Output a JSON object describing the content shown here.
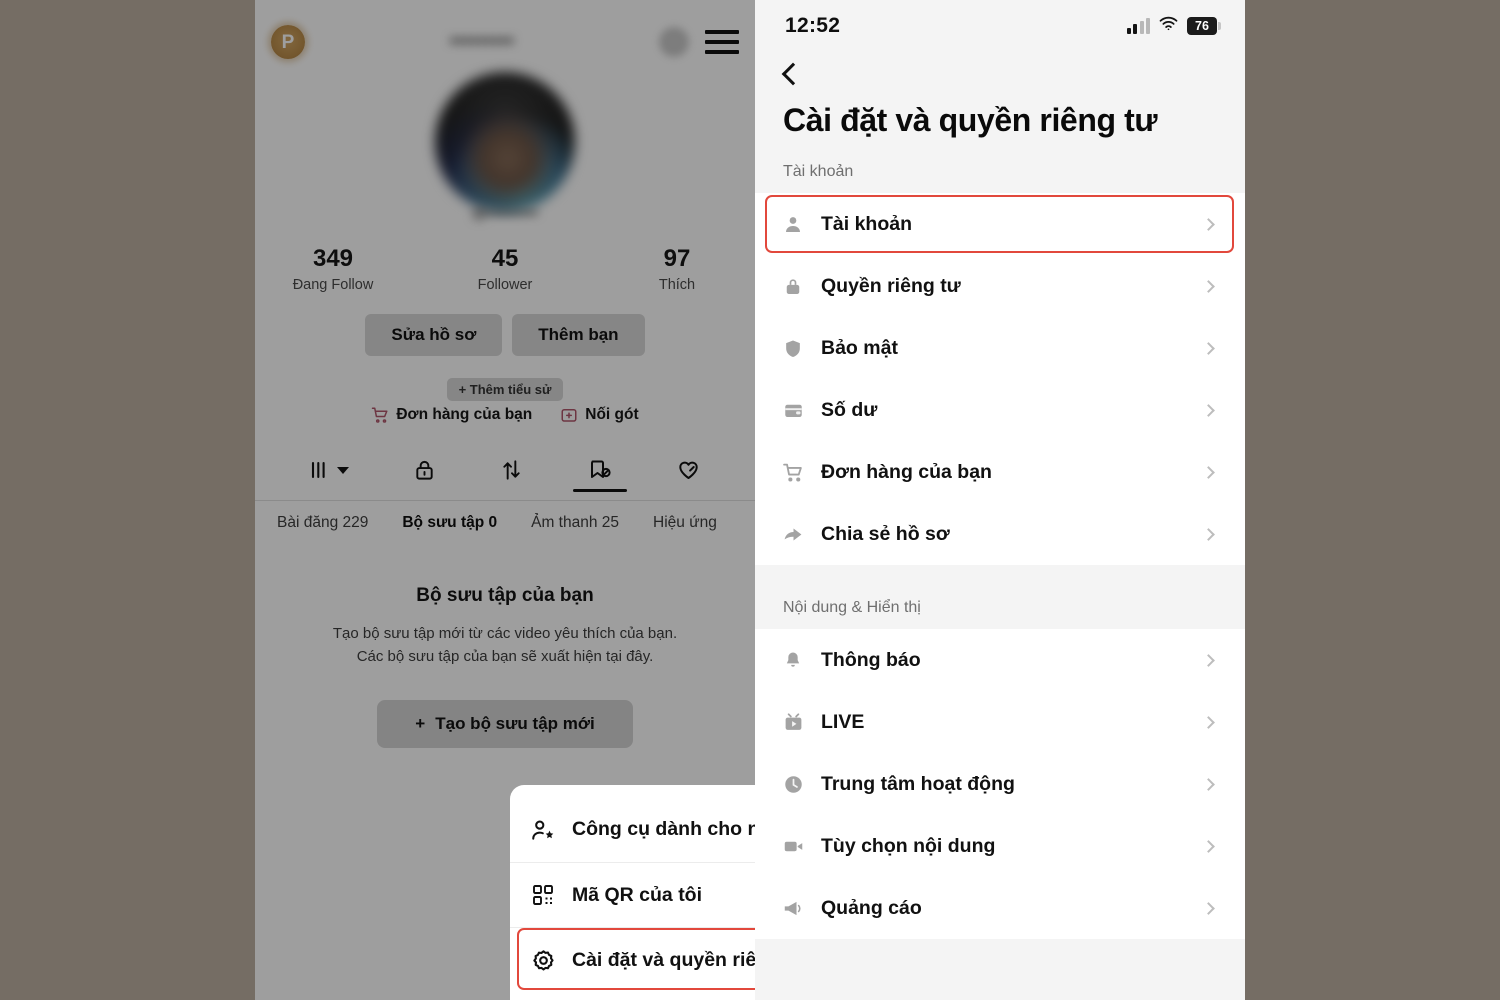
{
  "colors": {
    "page_background": "#756d64",
    "highlight_border": "#e2483c",
    "badge_dot": "#ea1f4e",
    "shop_accent": "#e8456b",
    "profile_badge": "#e08c12"
  },
  "left_phone": {
    "profile": {
      "badge_letter": "P",
      "username_hidden": "",
      "handle_hidden": "",
      "stats": [
        {
          "count": "349",
          "label": "Đang Follow"
        },
        {
          "count": "45",
          "label": "Follower"
        },
        {
          "count": "97",
          "label": "Thích"
        }
      ],
      "actions": [
        {
          "label": "Sửa hồ sơ"
        },
        {
          "label": "Thêm bạn"
        }
      ],
      "add_bio_label": "+ Thêm tiểu sử",
      "shop_links": [
        {
          "label": "Đơn hàng của bạn",
          "icon": "cart-icon"
        },
        {
          "label": "Nối gót",
          "icon": "box-plus-icon"
        }
      ],
      "icon_tabs": [
        {
          "icon": "grid-posts-icon",
          "active": false,
          "has_caret": true
        },
        {
          "icon": "lock-private-icon",
          "active": false
        },
        {
          "icon": "repost-icon",
          "active": false
        },
        {
          "icon": "collections-icon",
          "active": true
        },
        {
          "icon": "heart-liked-icon",
          "active": false
        }
      ],
      "text_tabs": [
        {
          "label": "Bài đăng 229",
          "active": false
        },
        {
          "label": "Bộ sưu tập 0",
          "active": true
        },
        {
          "label": "Ảm thanh 25",
          "active": false
        },
        {
          "label": "Hiệu ứng",
          "active": false
        }
      ],
      "empty_state": {
        "title": "Bộ sưu tập của bạn",
        "line1": "Tạo bộ sưu tập mới từ các video yêu thích của bạn.",
        "line2": "Các bộ sưu tập của bạn sẽ xuất hiện tại đây.",
        "button_label": "Tạo bộ sưu tập mới",
        "button_plus": "+"
      }
    },
    "bottom_sheet": {
      "items": [
        {
          "label": "Công cụ dành cho nhà sáng tạo",
          "icon": "creator-tools-icon",
          "badge_dot": true,
          "highlighted": false
        },
        {
          "label": "Mã QR của tôi",
          "icon": "qr-code-icon",
          "badge_dot": false,
          "highlighted": false
        },
        {
          "label": "Cài đặt và quyền riêng tư",
          "icon": "gear-icon",
          "badge_dot": false,
          "highlighted": true
        }
      ]
    }
  },
  "right_phone": {
    "status_bar": {
      "time": "12:52",
      "battery_level": "76",
      "signal_icon": "signal-bars-icon",
      "wifi_icon": "wifi-icon",
      "battery_icon": "battery-icon"
    },
    "back_icon": "back-chevron-icon",
    "title": "Cài đặt và quyền riêng tư",
    "sections": [
      {
        "header": "Tài khoản",
        "items": [
          {
            "label": "Tài khoản",
            "icon": "person-icon",
            "highlighted": true
          },
          {
            "label": "Quyền riêng tư",
            "icon": "lock-icon",
            "highlighted": false
          },
          {
            "label": "Bảo mật",
            "icon": "shield-icon",
            "highlighted": false
          },
          {
            "label": "Số dư",
            "icon": "wallet-icon",
            "highlighted": false
          },
          {
            "label": "Đơn hàng của bạn",
            "icon": "cart-icon",
            "highlighted": false
          },
          {
            "label": "Chia sẻ hồ sơ",
            "icon": "share-arrow-icon",
            "highlighted": false
          }
        ]
      },
      {
        "header": "Nội dung & Hiển thị",
        "items": [
          {
            "label": "Thông báo",
            "icon": "bell-icon",
            "highlighted": false
          },
          {
            "label": "LIVE",
            "icon": "live-icon",
            "highlighted": false
          },
          {
            "label": "Trung tâm hoạt động",
            "icon": "clock-icon",
            "highlighted": false
          },
          {
            "label": "Tùy chọn nội dung",
            "icon": "video-camera-icon",
            "highlighted": false
          },
          {
            "label": "Quảng cáo",
            "icon": "megaphone-icon",
            "highlighted": false
          }
        ]
      }
    ]
  }
}
